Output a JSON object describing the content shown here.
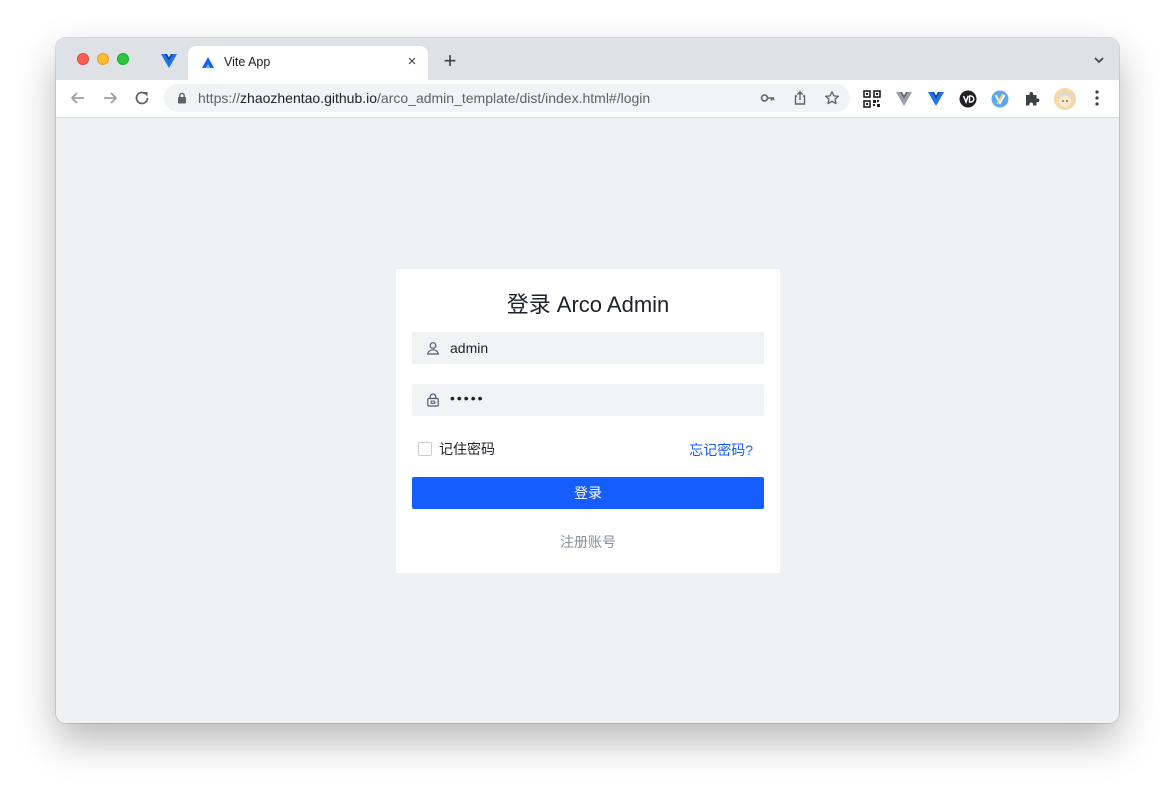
{
  "browser": {
    "tab_title": "Vite App",
    "tab_close": "×",
    "new_tab": "+",
    "url_scheme": "https://",
    "url_host": "zhaozhentao.github.io",
    "url_path": "/arco_admin_template/dist/index.html#/login"
  },
  "login": {
    "title": "登录 Arco Admin",
    "username_value": "admin",
    "password_value": "•••••",
    "remember_label": "记住密码",
    "forgot_label": "忘记密码?",
    "submit_label": "登录",
    "register_label": "注册账号"
  },
  "colors": {
    "primary": "#165dff",
    "page_background": "#f0f1f3",
    "input_background": "#f2f3f5"
  }
}
